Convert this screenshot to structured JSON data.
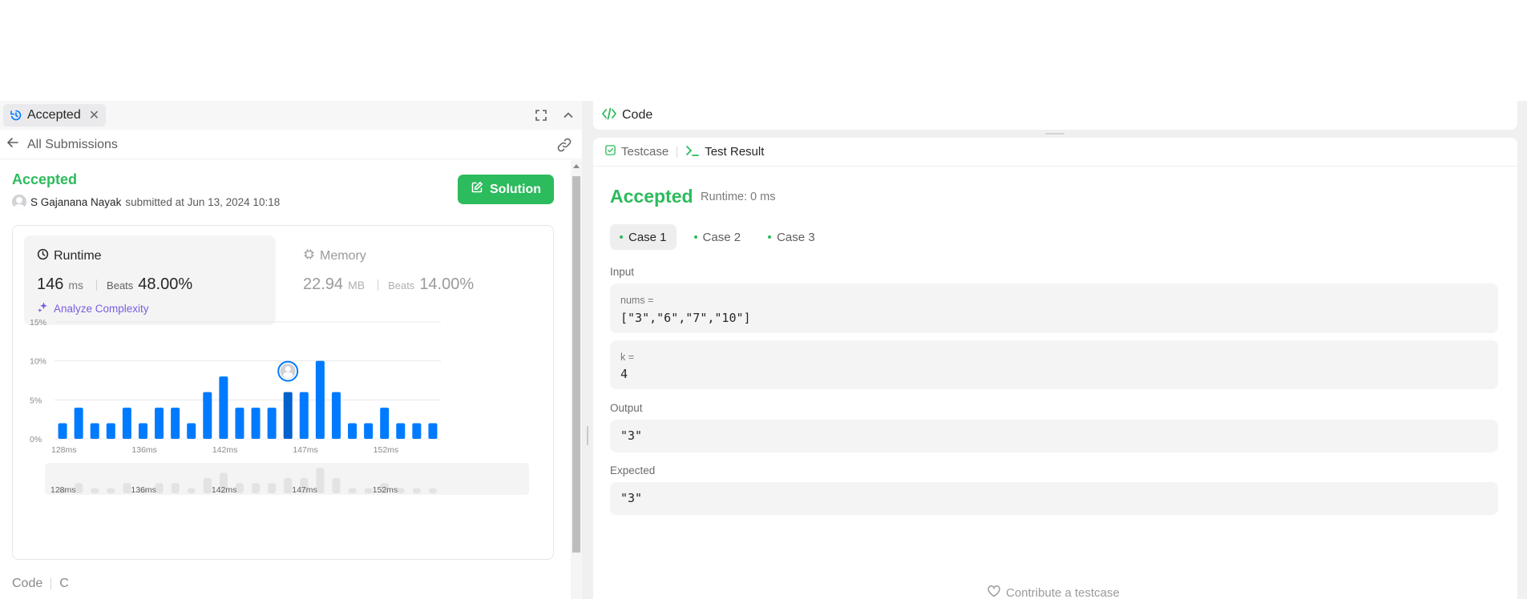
{
  "left_panel": {
    "tab": {
      "label": "Accepted"
    },
    "back_label": "All Submissions",
    "submission": {
      "status": "Accepted",
      "user": "S Gajanana Nayak",
      "submitted_text": "submitted at Jun 13, 2024 10:18",
      "solution_button": "Solution"
    },
    "runtime": {
      "label": "Runtime",
      "value": "146",
      "unit": "ms",
      "beats_label": "Beats",
      "beats": "48.00%",
      "analyze": "Analyze Complexity"
    },
    "memory": {
      "label": "Memory",
      "value": "22.94",
      "unit": "MB",
      "beats_label": "Beats",
      "beats": "14.00%"
    },
    "code_label": "Code",
    "language": "C"
  },
  "chart_data": {
    "type": "bar",
    "ylim": [
      0,
      15
    ],
    "yticks": [
      "0%",
      "5%",
      "10%",
      "15%"
    ],
    "xtick_labels": [
      "128ms",
      "136ms",
      "142ms",
      "147ms",
      "152ms"
    ],
    "values": [
      2,
      4,
      2,
      2,
      4,
      2,
      4,
      4,
      2,
      6,
      8,
      4,
      4,
      4,
      6,
      6,
      10,
      6,
      2,
      2,
      4,
      2,
      2,
      2
    ],
    "highlight_index": 14,
    "grid": true,
    "bar_color": "#007aff",
    "minimap_color": "#e3e3e3"
  },
  "right_panel": {
    "code_tab": "Code",
    "tabs": [
      "Testcase",
      "Test Result"
    ],
    "status": "Accepted",
    "runtime": "Runtime: 0 ms",
    "cases": [
      "Case 1",
      "Case 2",
      "Case 3"
    ],
    "input_label": "Input",
    "inputs": [
      {
        "name": "nums =",
        "value": "[\"3\",\"6\",\"7\",\"10\"]"
      },
      {
        "name": "k =",
        "value": "4"
      }
    ],
    "output_label": "Output",
    "output": "\"3\"",
    "expected_label": "Expected",
    "expected": "\"3\"",
    "contribute": "Contribute a testcase"
  },
  "colors": {
    "accent_green": "#2cbb5d",
    "bar_blue": "#007aff",
    "purple": "#7b5cde"
  }
}
